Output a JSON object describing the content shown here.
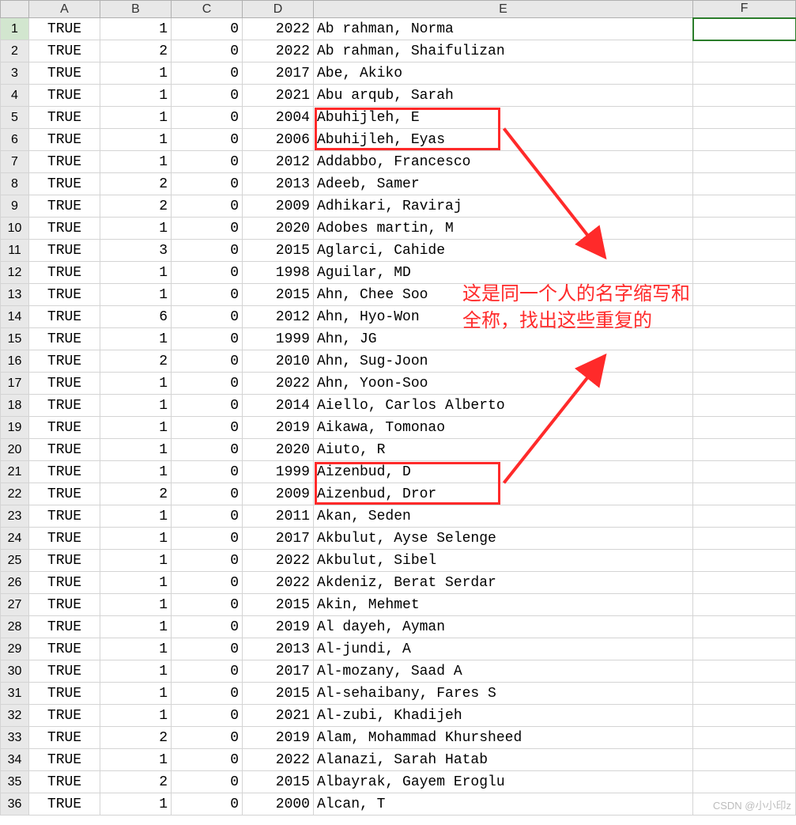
{
  "columns": [
    "A",
    "B",
    "C",
    "D",
    "E",
    "F"
  ],
  "selected_cell": {
    "row": 1,
    "col": "F"
  },
  "rows": [
    {
      "n": 1,
      "A": "TRUE",
      "B": "1",
      "C": "0",
      "D": "2022",
      "E": "Ab rahman, Norma",
      "F": ""
    },
    {
      "n": 2,
      "A": "TRUE",
      "B": "2",
      "C": "0",
      "D": "2022",
      "E": "Ab rahman, Shaifulizan",
      "F": ""
    },
    {
      "n": 3,
      "A": "TRUE",
      "B": "1",
      "C": "0",
      "D": "2017",
      "E": "Abe, Akiko",
      "F": ""
    },
    {
      "n": 4,
      "A": "TRUE",
      "B": "1",
      "C": "0",
      "D": "2021",
      "E": "Abu arqub, Sarah",
      "F": ""
    },
    {
      "n": 5,
      "A": "TRUE",
      "B": "1",
      "C": "0",
      "D": "2004",
      "E": "Abuhijleh, E",
      "F": ""
    },
    {
      "n": 6,
      "A": "TRUE",
      "B": "1",
      "C": "0",
      "D": "2006",
      "E": "Abuhijleh, Eyas",
      "F": ""
    },
    {
      "n": 7,
      "A": "TRUE",
      "B": "1",
      "C": "0",
      "D": "2012",
      "E": "Addabbo, Francesco",
      "F": ""
    },
    {
      "n": 8,
      "A": "TRUE",
      "B": "2",
      "C": "0",
      "D": "2013",
      "E": "Adeeb, Samer",
      "F": ""
    },
    {
      "n": 9,
      "A": "TRUE",
      "B": "2",
      "C": "0",
      "D": "2009",
      "E": "Adhikari, Raviraj",
      "F": ""
    },
    {
      "n": 10,
      "A": "TRUE",
      "B": "1",
      "C": "0",
      "D": "2020",
      "E": "Adobes martin, M",
      "F": ""
    },
    {
      "n": 11,
      "A": "TRUE",
      "B": "3",
      "C": "0",
      "D": "2015",
      "E": "Aglarci, Cahide",
      "F": ""
    },
    {
      "n": 12,
      "A": "TRUE",
      "B": "1",
      "C": "0",
      "D": "1998",
      "E": "Aguilar, MD",
      "F": ""
    },
    {
      "n": 13,
      "A": "TRUE",
      "B": "1",
      "C": "0",
      "D": "2015",
      "E": "Ahn, Chee Soo",
      "F": ""
    },
    {
      "n": 14,
      "A": "TRUE",
      "B": "6",
      "C": "0",
      "D": "2012",
      "E": "Ahn, Hyo-Won",
      "F": ""
    },
    {
      "n": 15,
      "A": "TRUE",
      "B": "1",
      "C": "0",
      "D": "1999",
      "E": "Ahn, JG",
      "F": ""
    },
    {
      "n": 16,
      "A": "TRUE",
      "B": "2",
      "C": "0",
      "D": "2010",
      "E": "Ahn, Sug-Joon",
      "F": ""
    },
    {
      "n": 17,
      "A": "TRUE",
      "B": "1",
      "C": "0",
      "D": "2022",
      "E": "Ahn, Yoon-Soo",
      "F": ""
    },
    {
      "n": 18,
      "A": "TRUE",
      "B": "1",
      "C": "0",
      "D": "2014",
      "E": "Aiello, Carlos Alberto",
      "F": ""
    },
    {
      "n": 19,
      "A": "TRUE",
      "B": "1",
      "C": "0",
      "D": "2019",
      "E": "Aikawa, Tomonao",
      "F": ""
    },
    {
      "n": 20,
      "A": "TRUE",
      "B": "1",
      "C": "0",
      "D": "2020",
      "E": "Aiuto, R",
      "F": ""
    },
    {
      "n": 21,
      "A": "TRUE",
      "B": "1",
      "C": "0",
      "D": "1999",
      "E": "Aizenbud, D",
      "F": ""
    },
    {
      "n": 22,
      "A": "TRUE",
      "B": "2",
      "C": "0",
      "D": "2009",
      "E": "Aizenbud, Dror",
      "F": ""
    },
    {
      "n": 23,
      "A": "TRUE",
      "B": "1",
      "C": "0",
      "D": "2011",
      "E": "Akan, Seden",
      "F": ""
    },
    {
      "n": 24,
      "A": "TRUE",
      "B": "1",
      "C": "0",
      "D": "2017",
      "E": "Akbulut, Ayse Selenge",
      "F": ""
    },
    {
      "n": 25,
      "A": "TRUE",
      "B": "1",
      "C": "0",
      "D": "2022",
      "E": "Akbulut, Sibel",
      "F": ""
    },
    {
      "n": 26,
      "A": "TRUE",
      "B": "1",
      "C": "0",
      "D": "2022",
      "E": "Akdeniz, Berat Serdar",
      "F": ""
    },
    {
      "n": 27,
      "A": "TRUE",
      "B": "1",
      "C": "0",
      "D": "2015",
      "E": "Akin, Mehmet",
      "F": ""
    },
    {
      "n": 28,
      "A": "TRUE",
      "B": "1",
      "C": "0",
      "D": "2019",
      "E": "Al dayeh, Ayman",
      "F": ""
    },
    {
      "n": 29,
      "A": "TRUE",
      "B": "1",
      "C": "0",
      "D": "2013",
      "E": "Al-jundi, A",
      "F": ""
    },
    {
      "n": 30,
      "A": "TRUE",
      "B": "1",
      "C": "0",
      "D": "2017",
      "E": "Al-mozany, Saad A",
      "F": ""
    },
    {
      "n": 31,
      "A": "TRUE",
      "B": "1",
      "C": "0",
      "D": "2015",
      "E": "Al-sehaibany, Fares S",
      "F": ""
    },
    {
      "n": 32,
      "A": "TRUE",
      "B": "1",
      "C": "0",
      "D": "2021",
      "E": "Al-zubi, Khadijeh",
      "F": ""
    },
    {
      "n": 33,
      "A": "TRUE",
      "B": "2",
      "C": "0",
      "D": "2019",
      "E": "Alam, Mohammad Khursheed",
      "F": ""
    },
    {
      "n": 34,
      "A": "TRUE",
      "B": "1",
      "C": "0",
      "D": "2022",
      "E": "Alanazi, Sarah Hatab",
      "F": ""
    },
    {
      "n": 35,
      "A": "TRUE",
      "B": "2",
      "C": "0",
      "D": "2015",
      "E": "Albayrak, Gayem Eroglu",
      "F": ""
    },
    {
      "n": 36,
      "A": "TRUE",
      "B": "1",
      "C": "0",
      "D": "2000",
      "E": "Alcan, T",
      "F": ""
    }
  ],
  "annotations": {
    "box1_rows": [
      5,
      6
    ],
    "box2_rows": [
      21,
      22
    ],
    "text_line1": "这是同一个人的名字缩写和",
    "text_line2": "全称，找出这些重复的"
  },
  "watermark": "CSDN @小小印z"
}
